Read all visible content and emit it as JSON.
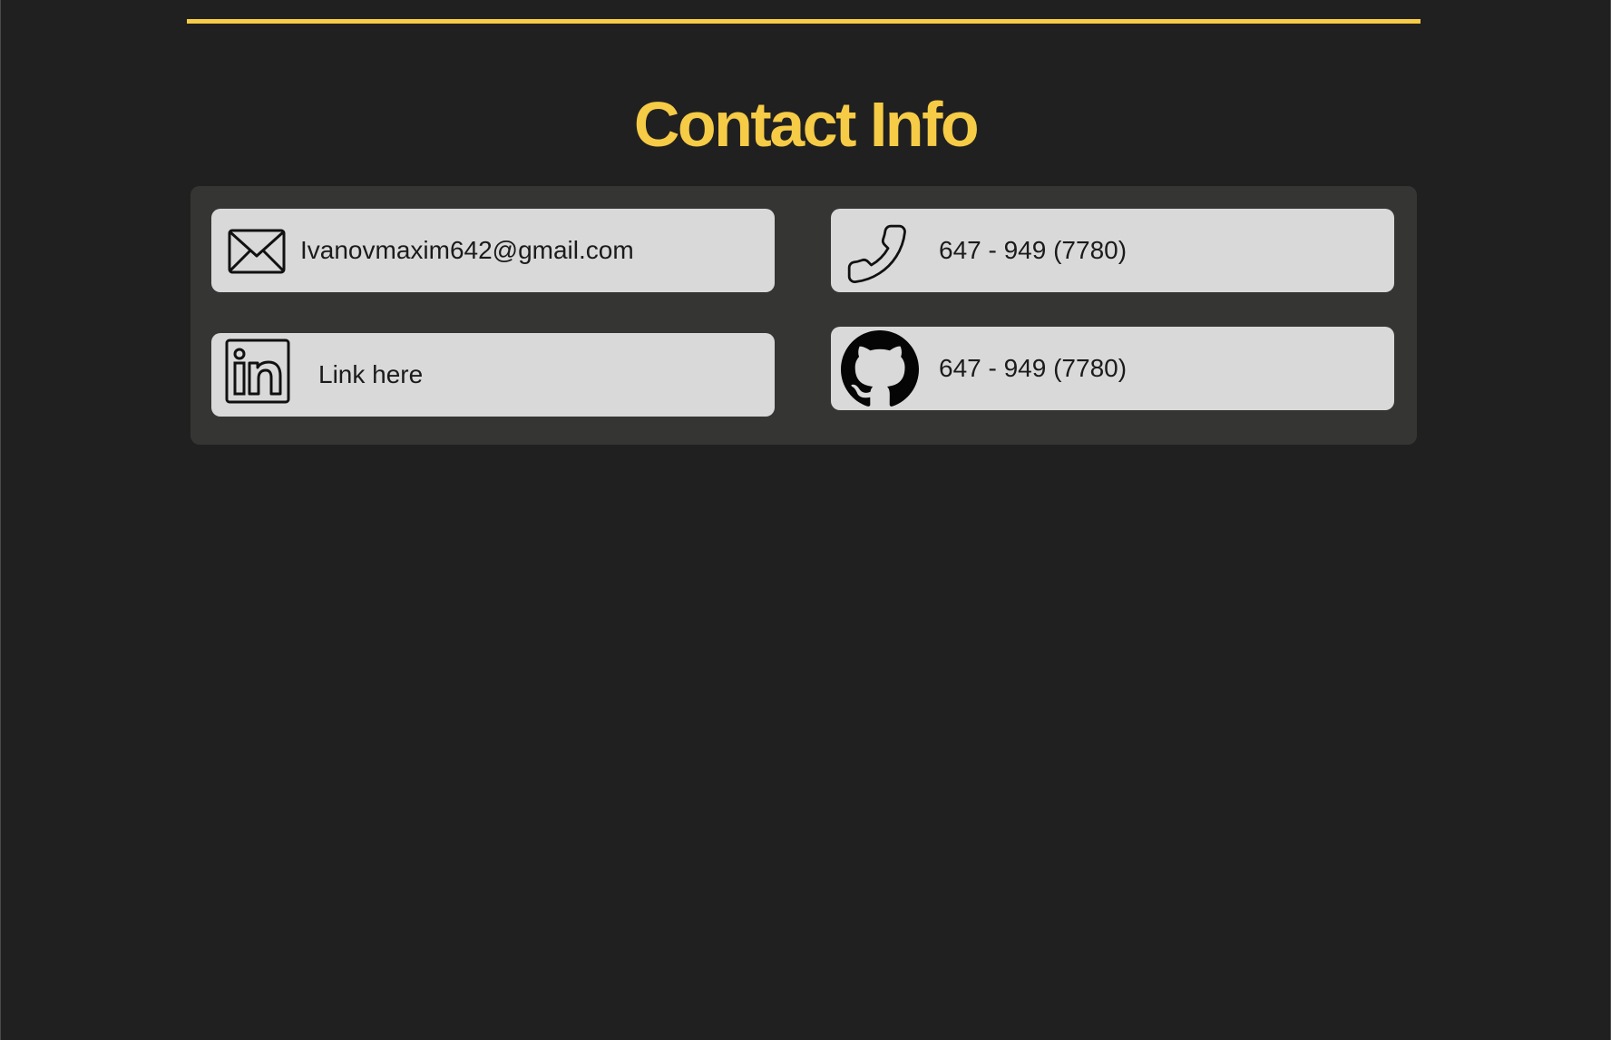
{
  "page": {
    "section_title": "Contact Info",
    "accent_color": "#f6cb46",
    "background_color": "#202020",
    "panel_color": "#353634",
    "card_color": "#d9d9d9"
  },
  "contacts": [
    {
      "id": "email",
      "icon": "mail-icon",
      "text": "Ivanovmaxim642@gmail.com"
    },
    {
      "id": "phone",
      "icon": "phone-icon",
      "text": "647 - 949 (7780)"
    },
    {
      "id": "linkedin",
      "icon": "linkedin-icon",
      "text": "Link here"
    },
    {
      "id": "github",
      "icon": "github-icon",
      "text": "647 - 949 (7780)"
    }
  ]
}
